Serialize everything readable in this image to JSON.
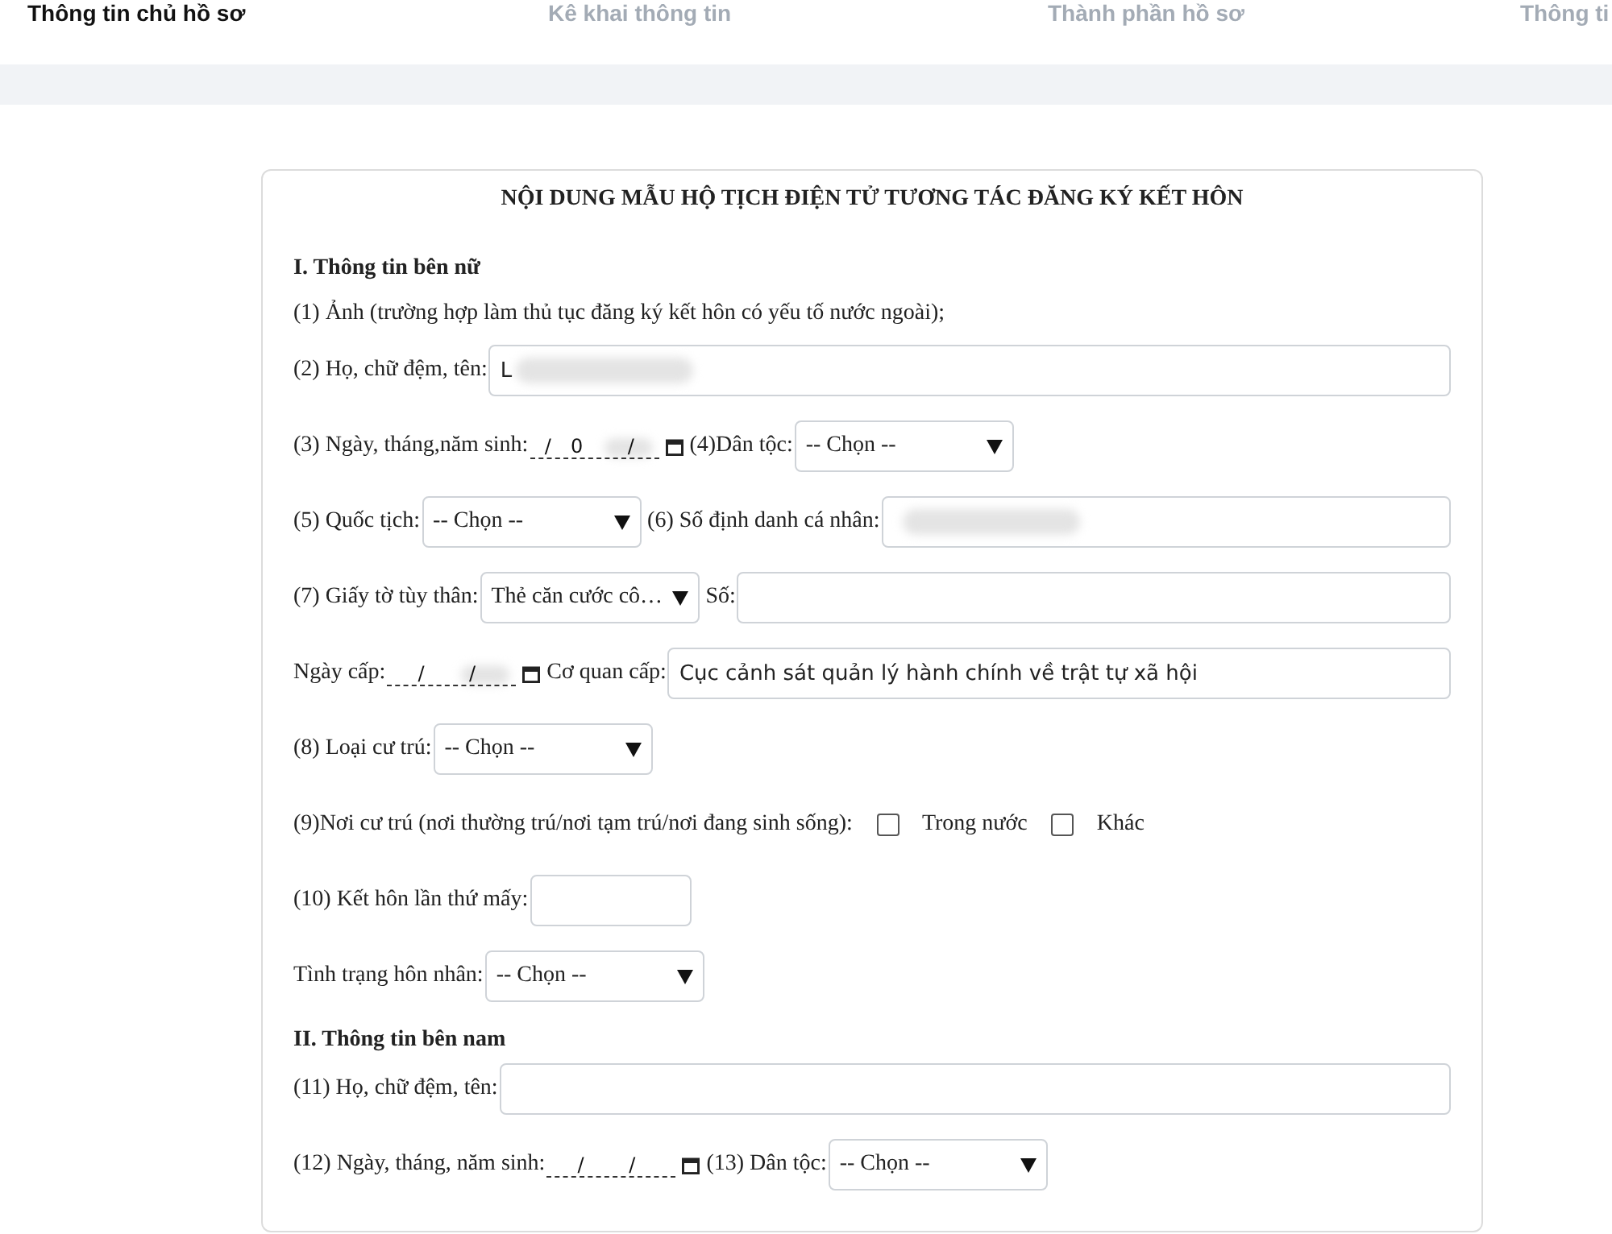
{
  "tabs": [
    {
      "label": "Thông tin chủ hồ sơ",
      "selected": true
    },
    {
      "label": "Kê khai thông tin",
      "selected": false
    },
    {
      "label": "Thành phần hồ sơ",
      "selected": false
    },
    {
      "label": "Thông ti",
      "selected": false
    }
  ],
  "form": {
    "title": "NỘI DUNG MẪU HỘ TỊCH ĐIỆN TỬ TƯƠNG TÁC ĐĂNG KÝ KẾT HÔN",
    "rows": [
      {
        "items": [
          {
            "kind": "heading",
            "text": "I. Thông tin bên nữ"
          }
        ]
      },
      {
        "items": [
          {
            "kind": "label",
            "text": "(1) Ảnh (trường hợp làm thủ tục đăng ký kết hôn có yếu tố nước ngoài);"
          }
        ]
      },
      {
        "items": [
          {
            "kind": "label",
            "text": "(2) Họ, chữ đệm, tên:"
          },
          {
            "kind": "input",
            "value": "L",
            "redacted": true
          }
        ]
      },
      {
        "items": [
          {
            "kind": "label",
            "text": "(3) Ngày, tháng,năm sinh:"
          },
          {
            "kind": "date",
            "value": "/0 /",
            "redacted": true
          },
          {
            "kind": "label",
            "text": "(4)Dân tộc:"
          },
          {
            "kind": "select",
            "value": "-- Chọn --"
          }
        ]
      },
      {
        "items": [
          {
            "kind": "label",
            "text": "(5) Quốc tịch:"
          },
          {
            "kind": "select",
            "value": "-- Chọn --"
          },
          {
            "kind": "label",
            "text": "(6) Số định danh cá nhân:"
          },
          {
            "kind": "input",
            "value": "",
            "redacted": true
          }
        ]
      },
      {
        "items": [
          {
            "kind": "label",
            "text": "(7) Giấy tờ tùy thân:"
          },
          {
            "kind": "select",
            "value": "Thẻ căn cước cô…"
          },
          {
            "kind": "label",
            "text": "Số:"
          },
          {
            "kind": "input",
            "value": ""
          }
        ]
      },
      {
        "items": [
          {
            "kind": "label",
            "text": "Ngày cấp:"
          },
          {
            "kind": "date",
            "value": "/ /",
            "redacted": true
          },
          {
            "kind": "label",
            "text": "Cơ quan cấp:"
          },
          {
            "kind": "input",
            "value": "Cục cảnh sát quản lý hành chính về trật tự xã hội"
          }
        ]
      },
      {
        "items": [
          {
            "kind": "label",
            "text": "(8) Loại cư trú:"
          },
          {
            "kind": "select",
            "value": "-- Chọn --"
          }
        ]
      },
      {
        "items": [
          {
            "kind": "label",
            "text": "(9)Nơi cư trú (nơi thường trú/nơi tạm trú/nơi đang sinh sống):"
          },
          {
            "kind": "checkbox",
            "text": "Trong nước",
            "checked": false
          },
          {
            "kind": "checkbox",
            "text": "Khác",
            "checked": false
          }
        ]
      },
      {
        "items": [
          {
            "kind": "label",
            "text": "(10) Kết hôn lần thứ mấy:"
          },
          {
            "kind": "short-input",
            "value": ""
          }
        ]
      },
      {
        "items": [
          {
            "kind": "label",
            "text": "Tình trạng hôn nhân:"
          },
          {
            "kind": "select",
            "value": "-- Chọn --"
          }
        ]
      },
      {
        "items": [
          {
            "kind": "heading",
            "text": "II. Thông tin bên nam"
          }
        ]
      },
      {
        "items": [
          {
            "kind": "label",
            "text": "(11) Họ, chữ đệm, tên:"
          },
          {
            "kind": "input",
            "value": ""
          }
        ]
      },
      {
        "items": [
          {
            "kind": "label",
            "text": "(12) Ngày, tháng, năm sinh:"
          },
          {
            "kind": "date",
            "value": "/ /"
          },
          {
            "kind": "label",
            "text": "(13) Dân tộc:"
          },
          {
            "kind": "select",
            "value": "-- Chọn --"
          }
        ]
      }
    ]
  }
}
